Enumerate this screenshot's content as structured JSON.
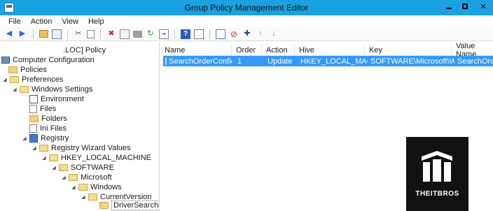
{
  "window": {
    "title": "Group Policy Management Editor",
    "minimize_glyph": "–",
    "close_glyph": "✕"
  },
  "menu": {
    "items": [
      "File",
      "Action",
      "View",
      "Help"
    ]
  },
  "toolbar": {
    "icons": [
      "back-icon",
      "forward-icon",
      "up-folder-icon",
      "show-tree-icon",
      "cut-icon",
      "copy-icon",
      "delete-icon",
      "properties-icon",
      "print-icon",
      "refresh-icon",
      "export-icon",
      "help-icon",
      "view-icon",
      "new-item-icon",
      "stop-icon",
      "add-icon",
      "move-up-icon",
      "move-down-icon"
    ]
  },
  "tree": {
    "root_label": ".LOC] Policy",
    "computer_configuration": "Computer Configuration",
    "policies": "Policies",
    "preferences": "Preferences",
    "windows_settings": "Windows Settings",
    "environment": "Environment",
    "files": "Files",
    "folders": "Folders",
    "ini_files": "Ini Files",
    "registry": "Registry",
    "registry_wizard_values": "Registry Wizard Values",
    "hklm": "HKEY_LOCAL_MACHINE",
    "software": "SOFTWARE",
    "microsoft": "Microsoft",
    "windows": "Windows",
    "current_version": "CurrentVersion",
    "driver_searching": "DriverSearching"
  },
  "list": {
    "columns": [
      "Name",
      "Order",
      "Action",
      "Hive",
      "Key",
      "Value Name"
    ],
    "rows": [
      {
        "name": "SearchOrderConfig",
        "order": "1",
        "action": "Update",
        "hive": "HKEY_LOCAL_MAC...",
        "key": "SOFTWARE\\Microsoft\\Wi...",
        "value_name": "SearchOrderC"
      }
    ]
  },
  "watermark": {
    "text": "THEITBROS"
  },
  "colors": {
    "titlebar": "#1ba1e2",
    "selection": "#3399ff"
  }
}
